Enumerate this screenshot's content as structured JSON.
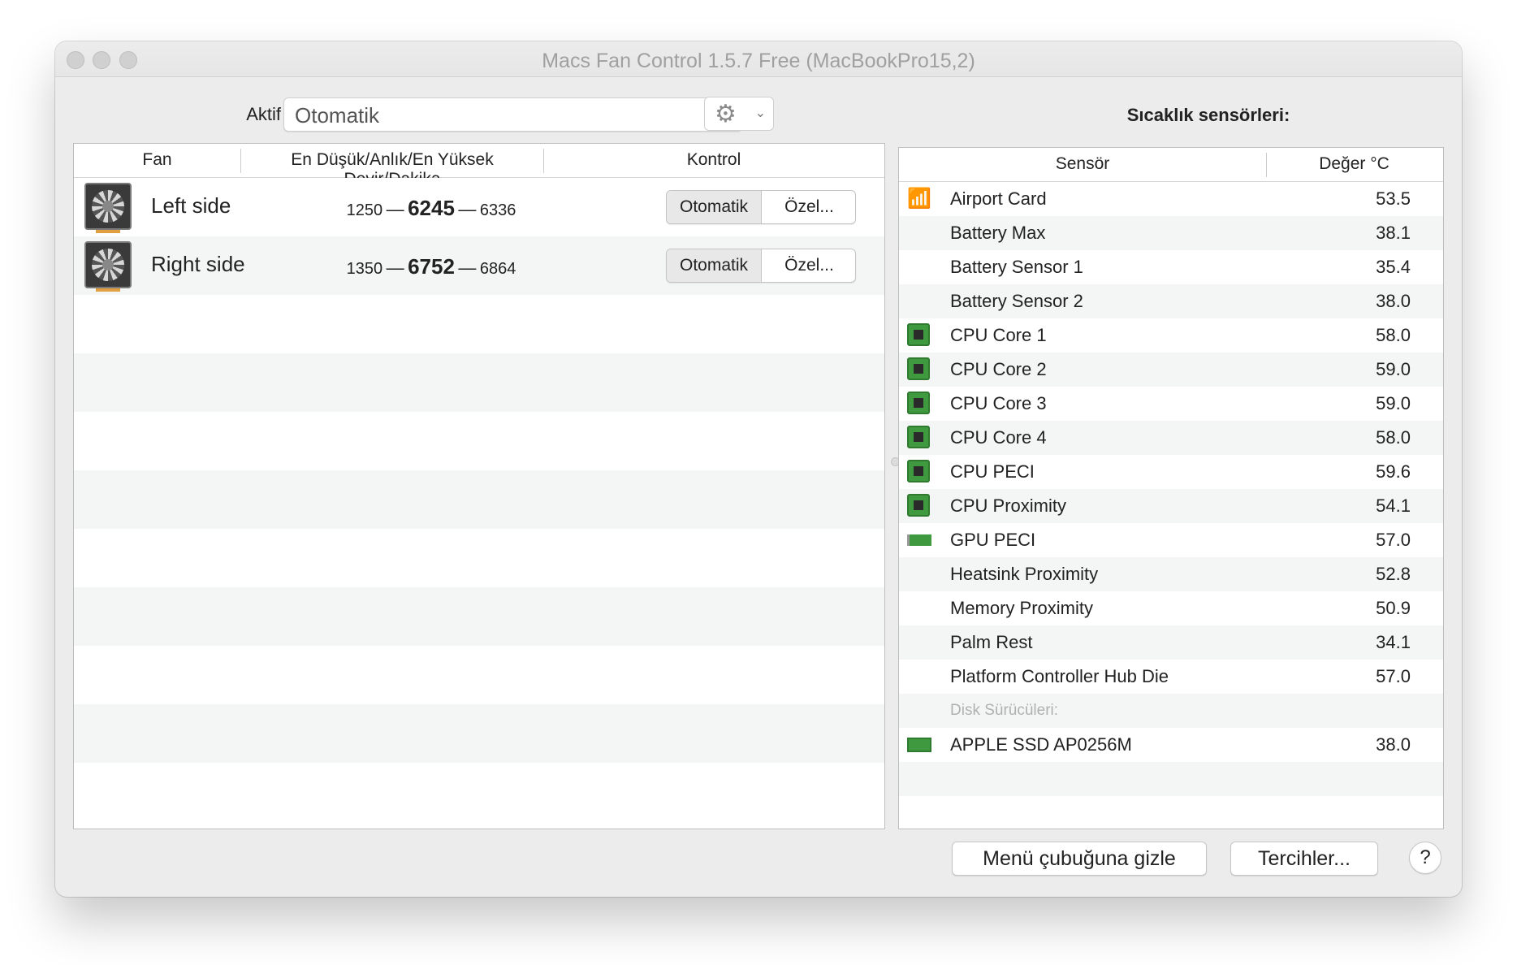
{
  "window": {
    "title": "Macs Fan Control 1.5.7 Free (MacBookPro15,2)"
  },
  "toolbar": {
    "active_preset_label": "Aktif ayar:",
    "active_preset_value": "Otomatik",
    "settings_icon": "gear-icon"
  },
  "fans": {
    "columns": {
      "fan": "Fan",
      "rpm": "En Düşük/Anlık/En Yüksek Devir/Dakika",
      "control": "Kontrol"
    },
    "rows": [
      {
        "name": "Left side",
        "min": "1250",
        "current": "6245",
        "max": "6336",
        "mode_auto": "Otomatik",
        "mode_custom": "Özel..."
      },
      {
        "name": "Right side",
        "min": "1350",
        "current": "6752",
        "max": "6864",
        "mode_auto": "Otomatik",
        "mode_custom": "Özel..."
      }
    ],
    "separator": "—"
  },
  "sensors": {
    "title": "Sıcaklık sensörleri:",
    "columns": {
      "sensor": "Sensör",
      "value": "Değer °C"
    },
    "rows": [
      {
        "name": "Airport Card",
        "value": "53.5",
        "icon": "wifi-icon"
      },
      {
        "name": "Battery Max",
        "value": "38.1",
        "icon": ""
      },
      {
        "name": "Battery Sensor 1",
        "value": "35.4",
        "icon": ""
      },
      {
        "name": "Battery Sensor 2",
        "value": "38.0",
        "icon": ""
      },
      {
        "name": "CPU Core 1",
        "value": "58.0",
        "icon": "cpu-icon"
      },
      {
        "name": "CPU Core 2",
        "value": "59.0",
        "icon": "cpu-icon"
      },
      {
        "name": "CPU Core 3",
        "value": "59.0",
        "icon": "cpu-icon"
      },
      {
        "name": "CPU Core 4",
        "value": "58.0",
        "icon": "cpu-icon"
      },
      {
        "name": "CPU PECI",
        "value": "59.6",
        "icon": "cpu-icon"
      },
      {
        "name": "CPU Proximity",
        "value": "54.1",
        "icon": "cpu-icon"
      },
      {
        "name": "GPU PECI",
        "value": "57.0",
        "icon": "gpu-icon"
      },
      {
        "name": "Heatsink Proximity",
        "value": "52.8",
        "icon": ""
      },
      {
        "name": "Memory Proximity",
        "value": "50.9",
        "icon": ""
      },
      {
        "name": "Palm Rest",
        "value": "34.1",
        "icon": ""
      },
      {
        "name": "Platform Controller Hub Die",
        "value": "57.0",
        "icon": ""
      }
    ],
    "disk_group_label": "Disk Sürücüleri:",
    "disks": [
      {
        "name": "APPLE SSD AP0256M",
        "value": "38.0",
        "icon": "ssd-icon"
      }
    ]
  },
  "footer": {
    "hide_to_menubar": "Menü çubuğuna gizle",
    "preferences": "Tercihler...",
    "help": "?"
  }
}
